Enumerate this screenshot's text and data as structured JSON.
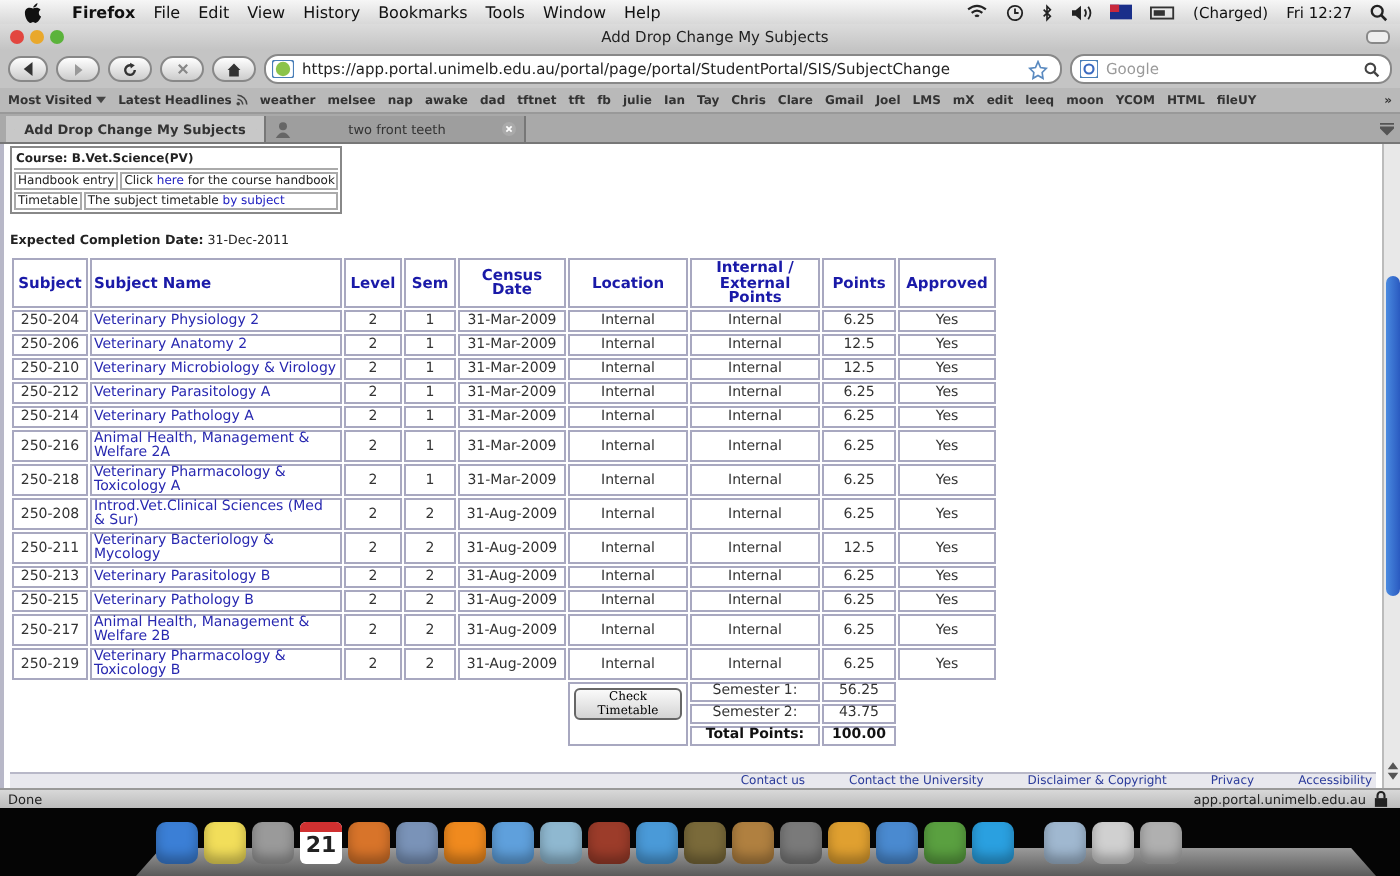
{
  "menubar": {
    "app": "Firefox",
    "menus": [
      "File",
      "Edit",
      "View",
      "History",
      "Bookmarks",
      "Tools",
      "Window",
      "Help"
    ],
    "battery": "(Charged)",
    "clock": "Fri 12:27"
  },
  "window": {
    "title": "Add Drop Change My Subjects"
  },
  "toolbar": {
    "url": "https://app.portal.unimelb.edu.au/portal/page/portal/StudentPortal/SIS/SubjectChange",
    "search_placeholder": "Google"
  },
  "bookmarks": {
    "items": [
      "Most Visited",
      "Latest Headlines",
      "weather",
      "melsee",
      "nap",
      "awake",
      "dad",
      "tftnet",
      "tft",
      "fb",
      "julie",
      "Ian",
      "Tay",
      "Chris",
      "Clare",
      "Gmail",
      "Joel",
      "LMS",
      "mX",
      "edit",
      "leeq",
      "moon",
      "YCOM",
      "HTML",
      "fileUY"
    ],
    "overflow": "»"
  },
  "tabs": [
    {
      "label": "Add Drop Change My Subjects",
      "selected": true
    },
    {
      "label": "two front teeth",
      "selected": false
    }
  ],
  "course_box": {
    "title": "Course: B.Vet.Science(PV)",
    "rows": [
      {
        "label": "Handbook entry",
        "before": "Click ",
        "link": "here",
        "after": " for the course handbook"
      },
      {
        "label": "Timetable",
        "before": "The subject timetable ",
        "link": "by subject",
        "after": ""
      }
    ]
  },
  "completion": {
    "label": "Expected Completion Date:",
    "value": "31-Dec-2011"
  },
  "table": {
    "columns": [
      "Subject",
      "Subject Name",
      "Level",
      "Sem",
      "Census Date",
      "Location",
      "Internal / External Points",
      "Points",
      "Approved"
    ],
    "rows": [
      [
        "250-204",
        "Veterinary Physiology 2",
        "2",
        "1",
        "31-Mar-2009",
        "Internal",
        "Internal",
        "6.25",
        "Yes"
      ],
      [
        "250-206",
        "Veterinary Anatomy 2",
        "2",
        "1",
        "31-Mar-2009",
        "Internal",
        "Internal",
        "12.5",
        "Yes"
      ],
      [
        "250-210",
        "Veterinary Microbiology & Virology",
        "2",
        "1",
        "31-Mar-2009",
        "Internal",
        "Internal",
        "12.5",
        "Yes"
      ],
      [
        "250-212",
        "Veterinary Parasitology A",
        "2",
        "1",
        "31-Mar-2009",
        "Internal",
        "Internal",
        "6.25",
        "Yes"
      ],
      [
        "250-214",
        "Veterinary Pathology A",
        "2",
        "1",
        "31-Mar-2009",
        "Internal",
        "Internal",
        "6.25",
        "Yes"
      ],
      [
        "250-216",
        "Animal Health, Management & Welfare 2A",
        "2",
        "1",
        "31-Mar-2009",
        "Internal",
        "Internal",
        "6.25",
        "Yes"
      ],
      [
        "250-218",
        "Veterinary Pharmacology & Toxicology A",
        "2",
        "1",
        "31-Mar-2009",
        "Internal",
        "Internal",
        "6.25",
        "Yes"
      ],
      [
        "250-208",
        "Introd.Vet.Clinical Sciences (Med & Sur)",
        "2",
        "2",
        "31-Aug-2009",
        "Internal",
        "Internal",
        "6.25",
        "Yes"
      ],
      [
        "250-211",
        "Veterinary Bacteriology & Mycology",
        "2",
        "2",
        "31-Aug-2009",
        "Internal",
        "Internal",
        "12.5",
        "Yes"
      ],
      [
        "250-213",
        "Veterinary Parasitology B",
        "2",
        "2",
        "31-Aug-2009",
        "Internal",
        "Internal",
        "6.25",
        "Yes"
      ],
      [
        "250-215",
        "Veterinary Pathology B",
        "2",
        "2",
        "31-Aug-2009",
        "Internal",
        "Internal",
        "6.25",
        "Yes"
      ],
      [
        "250-217",
        "Animal Health, Management & Welfare 2B",
        "2",
        "2",
        "31-Aug-2009",
        "Internal",
        "Internal",
        "6.25",
        "Yes"
      ],
      [
        "250-219",
        "Veterinary Pharmacology & Toxicology B",
        "2",
        "2",
        "31-Aug-2009",
        "Internal",
        "Internal",
        "6.25",
        "Yes"
      ]
    ]
  },
  "totals": {
    "button": "Check Timetable",
    "rows": [
      {
        "label": "Semester 1:",
        "value": "56.25",
        "kind": "subtotal"
      },
      {
        "label": "Semester 2:",
        "value": "43.75",
        "kind": "subtotal"
      },
      {
        "label": "Total Points:",
        "value": "100.00",
        "kind": "total"
      }
    ]
  },
  "footer_links": [
    "Contact us",
    "Contact the University",
    "Disclaimer & Copyright",
    "Privacy",
    "Accessibility"
  ],
  "status_bar": {
    "text": "Done",
    "host": "app.portal.unimelb.edu.au"
  },
  "dock": {
    "calendar_day": "21"
  }
}
